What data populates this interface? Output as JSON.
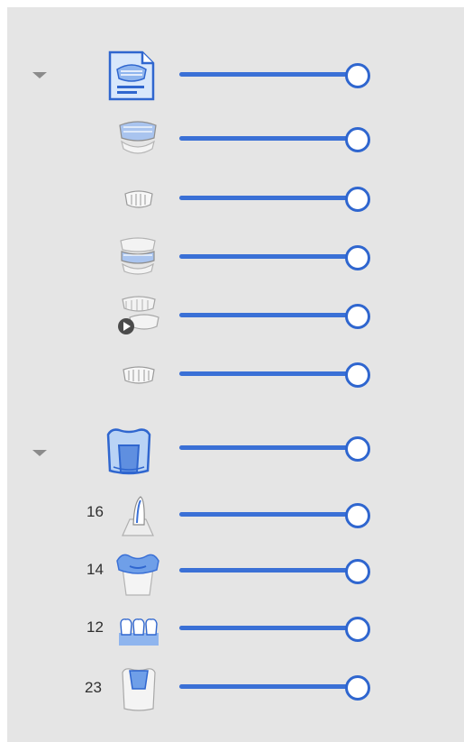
{
  "colors": {
    "panel_bg": "#e5e5e5",
    "slider_accent": "#3a70d6",
    "thumb_border": "#2f66cf",
    "chevron": "#8b8b8b"
  },
  "groups": [
    {
      "name": "scan-data",
      "collapse_icon": "chevron-down-icon",
      "header": {
        "icon": "scan-document-icon",
        "opacity": 1.0
      },
      "items": [
        {
          "icon": "maxillary-jaw-scan-icon",
          "opacity": 1.0
        },
        {
          "icon": "prepared-tooth-scan-icon",
          "opacity": 1.0
        },
        {
          "icon": "bite-scan-icon",
          "opacity": 1.0
        },
        {
          "icon": "pre-op-scan-icon",
          "opacity": 1.0
        },
        {
          "icon": "antagonist-scan-icon",
          "opacity": 1.0
        }
      ]
    },
    {
      "name": "restorations",
      "collapse_icon": "chevron-down-icon",
      "header": {
        "icon": "crown-restoration-icon",
        "opacity": 1.0
      },
      "items": [
        {
          "tooth": "16",
          "icon": "post-core-icon",
          "opacity": 1.0
        },
        {
          "tooth": "14",
          "icon": "crown-icon",
          "opacity": 1.0
        },
        {
          "tooth": "12",
          "icon": "bridge-icon",
          "opacity": 1.0
        },
        {
          "tooth": "23",
          "icon": "inlay-icon",
          "opacity": 1.0
        }
      ]
    }
  ]
}
